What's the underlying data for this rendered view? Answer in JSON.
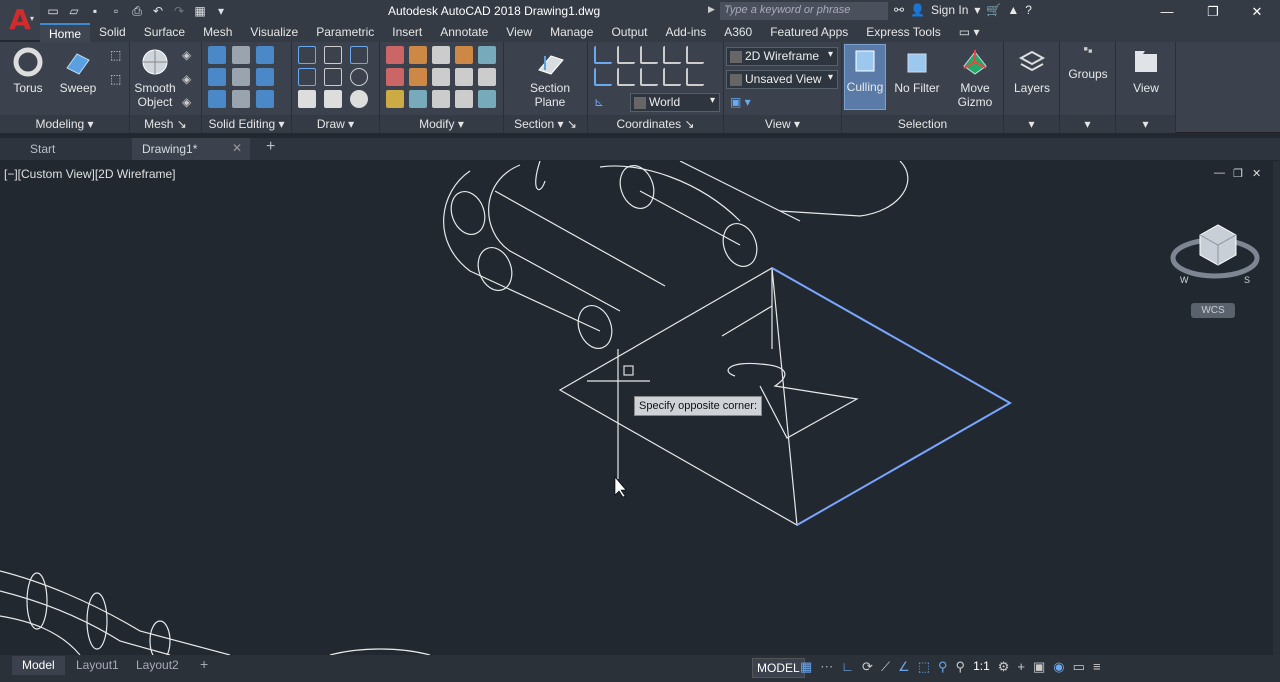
{
  "title": "Autodesk AutoCAD 2018    Drawing1.dwg",
  "app_letter": "A",
  "search": {
    "placeholder": "Type a keyword or phrase"
  },
  "sign_in": "Sign In",
  "ribbon_tabs": [
    "Home",
    "Solid",
    "Surface",
    "Mesh",
    "Visualize",
    "Parametric",
    "Insert",
    "Annotate",
    "View",
    "Manage",
    "Output",
    "Add-ins",
    "A360",
    "Featured Apps",
    "Express Tools"
  ],
  "big_buttons": {
    "torus": "Torus",
    "sweep": "Sweep",
    "smooth_object": "Smooth Object",
    "section_plane": "Section Plane",
    "culling": "Culling",
    "no_filter": "No Filter",
    "move_gizmo": "Move Gizmo",
    "layers": "Layers",
    "groups": "Groups",
    "view": "View"
  },
  "panels": {
    "modeling": "Modeling",
    "mesh": "Mesh",
    "solid_editing": "Solid Editing",
    "draw": "Draw",
    "modify": "Modify",
    "section": "Section",
    "coordinates": "Coordinates",
    "view": "View",
    "selection": "Selection"
  },
  "combos": {
    "visual_style": "2D Wireframe",
    "named_view": "Unsaved View",
    "ucs": "World"
  },
  "file_tabs": [
    "Start",
    "Drawing1*"
  ],
  "viewport_label": "[−][Custom View][2D Wireframe]",
  "tooltip": "Specify opposite corner:",
  "wcs_label": "WCS",
  "layout_tabs": [
    "Model",
    "Layout1",
    "Layout2"
  ],
  "status": {
    "model": "MODEL",
    "scale": "1:1"
  },
  "colors": {
    "accent": "#3a8ad6",
    "background": "#212830",
    "selection": "#6f9eff",
    "app_red": "#d22b2b"
  }
}
